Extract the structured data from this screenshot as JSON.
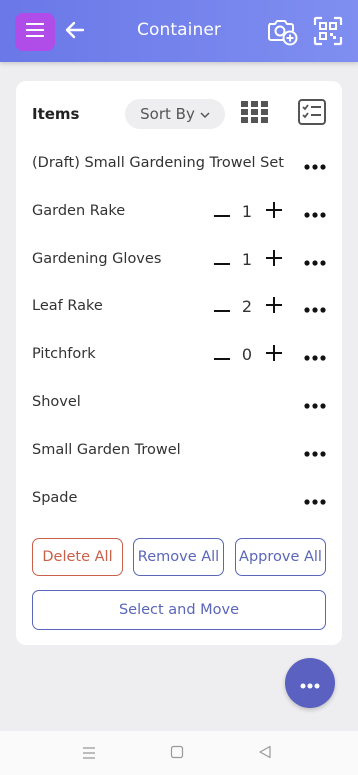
{
  "header": {
    "title": "Container",
    "background_color": "#7381ec",
    "menu_color": "#b04ce8"
  },
  "card": {
    "title": "Items",
    "sort_label": "Sort By"
  },
  "items": [
    {
      "name": "(Draft) Small Gardening Trowel Set",
      "quantity": null
    },
    {
      "name": "Garden Rake",
      "quantity": "1"
    },
    {
      "name": "Gardening Gloves",
      "quantity": "1"
    },
    {
      "name": "Leaf Rake",
      "quantity": "2"
    },
    {
      "name": "Pitchfork",
      "quantity": "0"
    },
    {
      "name": "Shovel",
      "quantity": null
    },
    {
      "name": "Small Garden Trowel",
      "quantity": null
    },
    {
      "name": "Spade",
      "quantity": null
    }
  ],
  "actions": {
    "delete_all": "Delete All",
    "remove_all": "Remove All",
    "approve_all": "Approve All",
    "select_and_move": "Select and Move"
  },
  "icons": {
    "menu": "hamburger-icon",
    "back": "arrow-left-icon",
    "camera": "camera-add-icon",
    "qr": "qr-scan-icon",
    "grid": "grid-view-icon",
    "checklist": "checklist-icon",
    "more": "more-horizontal-icon"
  },
  "colors": {
    "accent": "#5a66b8",
    "danger": "#c9604a",
    "fab": "#5a61c0"
  }
}
